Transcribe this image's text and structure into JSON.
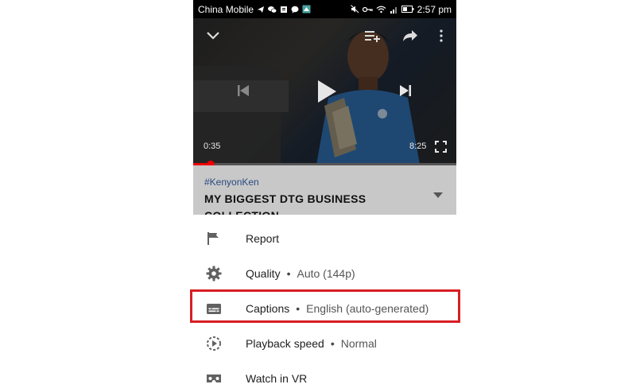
{
  "status_bar": {
    "carrier": "China Mobile",
    "time": "2:57 pm"
  },
  "player": {
    "current_time": "0:35",
    "total_time": "8:25",
    "progress": 0.069
  },
  "video_info": {
    "hashtag": "#KenyonKen",
    "title": "MY BIGGEST DTG BUSINESS COLLECTION"
  },
  "menu": {
    "items": [
      {
        "label": "Report",
        "icon": "flag-icon"
      },
      {
        "label": "Quality",
        "value": "Auto (144p)",
        "icon": "gear-icon"
      },
      {
        "label": "Captions",
        "value": "English (auto-generated)",
        "icon": "captions-icon"
      },
      {
        "label": "Playback speed",
        "value": "Normal",
        "icon": "playback-speed-icon"
      },
      {
        "label": "Watch in VR",
        "icon": "vr-headset-icon"
      }
    ],
    "separator": "•"
  },
  "colors": {
    "highlight": "#d81e24",
    "progress": "#ee0000",
    "hashtag": "#2a4a80"
  }
}
